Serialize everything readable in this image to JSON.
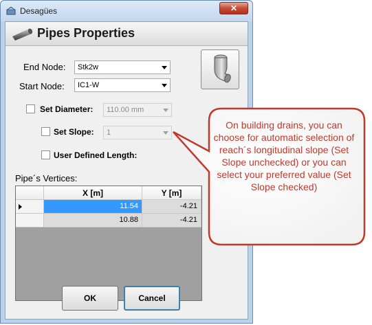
{
  "window": {
    "title": "Desagües",
    "close_glyph": "✕"
  },
  "header": {
    "title": "Pipes Properties"
  },
  "end_node": {
    "label": "End Node:",
    "value": "Stk2w"
  },
  "start_node": {
    "label": "Start Node:",
    "value": "IC1-W"
  },
  "set_diameter": {
    "label": "Set Diameter:",
    "value": "110.00 mm",
    "checked": false
  },
  "set_slope": {
    "label": "Set Slope:",
    "value": "1",
    "checked": false
  },
  "user_length": {
    "label": "User Defined Length:",
    "checked": false
  },
  "vertices": {
    "label": "Pipe´s Vertices:",
    "columns": [
      "X [m]",
      "Y [m]"
    ],
    "rows": [
      {
        "x": "11.54",
        "y": "-4.21",
        "current": true
      },
      {
        "x": "10.88",
        "y": "-4.21",
        "current": false
      }
    ]
  },
  "buttons": {
    "ok": "OK",
    "cancel": "Cancel"
  },
  "callout": {
    "text": "On building drains, you can choose for automatic selection of reach´s longitudinal slope (Set Slope unchecked) or you can select your preferred value (Set Slope checked)",
    "color": "#c0392b"
  },
  "icons": [
    "app-icon",
    "pipe-icon",
    "elbow-icon",
    "row-pointer-icon",
    "close-icon"
  ]
}
